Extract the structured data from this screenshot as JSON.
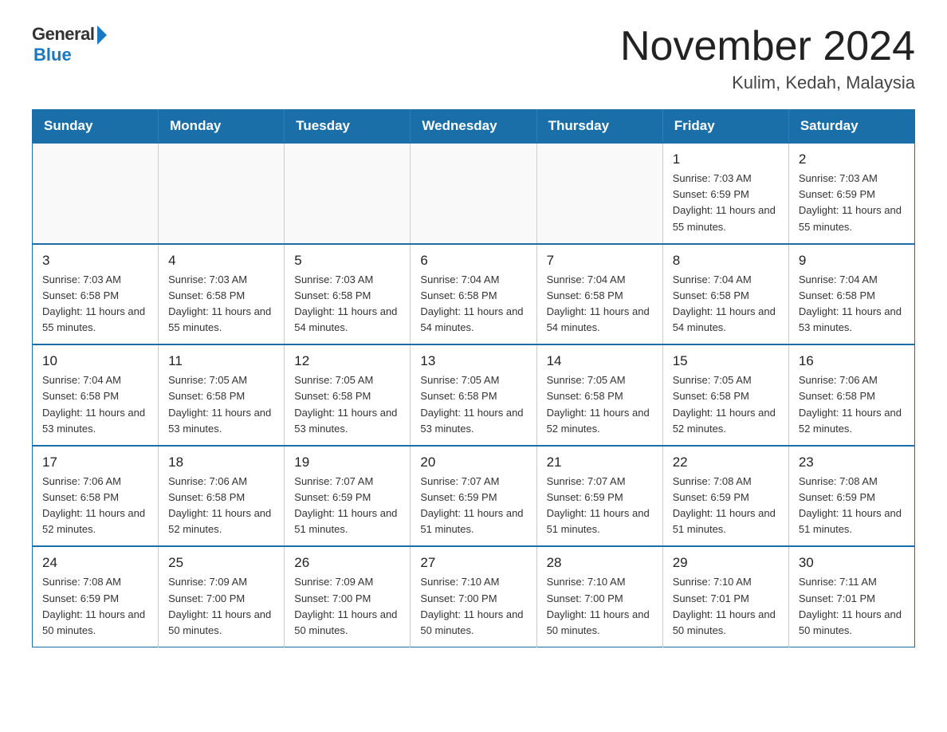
{
  "header": {
    "logo_general": "General",
    "logo_blue": "Blue",
    "title": "November 2024",
    "subtitle": "Kulim, Kedah, Malaysia"
  },
  "calendar": {
    "days_of_week": [
      "Sunday",
      "Monday",
      "Tuesday",
      "Wednesday",
      "Thursday",
      "Friday",
      "Saturday"
    ],
    "weeks": [
      [
        {
          "day": "",
          "info": ""
        },
        {
          "day": "",
          "info": ""
        },
        {
          "day": "",
          "info": ""
        },
        {
          "day": "",
          "info": ""
        },
        {
          "day": "",
          "info": ""
        },
        {
          "day": "1",
          "info": "Sunrise: 7:03 AM\nSunset: 6:59 PM\nDaylight: 11 hours and 55 minutes."
        },
        {
          "day": "2",
          "info": "Sunrise: 7:03 AM\nSunset: 6:59 PM\nDaylight: 11 hours and 55 minutes."
        }
      ],
      [
        {
          "day": "3",
          "info": "Sunrise: 7:03 AM\nSunset: 6:58 PM\nDaylight: 11 hours and 55 minutes."
        },
        {
          "day": "4",
          "info": "Sunrise: 7:03 AM\nSunset: 6:58 PM\nDaylight: 11 hours and 55 minutes."
        },
        {
          "day": "5",
          "info": "Sunrise: 7:03 AM\nSunset: 6:58 PM\nDaylight: 11 hours and 54 minutes."
        },
        {
          "day": "6",
          "info": "Sunrise: 7:04 AM\nSunset: 6:58 PM\nDaylight: 11 hours and 54 minutes."
        },
        {
          "day": "7",
          "info": "Sunrise: 7:04 AM\nSunset: 6:58 PM\nDaylight: 11 hours and 54 minutes."
        },
        {
          "day": "8",
          "info": "Sunrise: 7:04 AM\nSunset: 6:58 PM\nDaylight: 11 hours and 54 minutes."
        },
        {
          "day": "9",
          "info": "Sunrise: 7:04 AM\nSunset: 6:58 PM\nDaylight: 11 hours and 53 minutes."
        }
      ],
      [
        {
          "day": "10",
          "info": "Sunrise: 7:04 AM\nSunset: 6:58 PM\nDaylight: 11 hours and 53 minutes."
        },
        {
          "day": "11",
          "info": "Sunrise: 7:05 AM\nSunset: 6:58 PM\nDaylight: 11 hours and 53 minutes."
        },
        {
          "day": "12",
          "info": "Sunrise: 7:05 AM\nSunset: 6:58 PM\nDaylight: 11 hours and 53 minutes."
        },
        {
          "day": "13",
          "info": "Sunrise: 7:05 AM\nSunset: 6:58 PM\nDaylight: 11 hours and 53 minutes."
        },
        {
          "day": "14",
          "info": "Sunrise: 7:05 AM\nSunset: 6:58 PM\nDaylight: 11 hours and 52 minutes."
        },
        {
          "day": "15",
          "info": "Sunrise: 7:05 AM\nSunset: 6:58 PM\nDaylight: 11 hours and 52 minutes."
        },
        {
          "day": "16",
          "info": "Sunrise: 7:06 AM\nSunset: 6:58 PM\nDaylight: 11 hours and 52 minutes."
        }
      ],
      [
        {
          "day": "17",
          "info": "Sunrise: 7:06 AM\nSunset: 6:58 PM\nDaylight: 11 hours and 52 minutes."
        },
        {
          "day": "18",
          "info": "Sunrise: 7:06 AM\nSunset: 6:58 PM\nDaylight: 11 hours and 52 minutes."
        },
        {
          "day": "19",
          "info": "Sunrise: 7:07 AM\nSunset: 6:59 PM\nDaylight: 11 hours and 51 minutes."
        },
        {
          "day": "20",
          "info": "Sunrise: 7:07 AM\nSunset: 6:59 PM\nDaylight: 11 hours and 51 minutes."
        },
        {
          "day": "21",
          "info": "Sunrise: 7:07 AM\nSunset: 6:59 PM\nDaylight: 11 hours and 51 minutes."
        },
        {
          "day": "22",
          "info": "Sunrise: 7:08 AM\nSunset: 6:59 PM\nDaylight: 11 hours and 51 minutes."
        },
        {
          "day": "23",
          "info": "Sunrise: 7:08 AM\nSunset: 6:59 PM\nDaylight: 11 hours and 51 minutes."
        }
      ],
      [
        {
          "day": "24",
          "info": "Sunrise: 7:08 AM\nSunset: 6:59 PM\nDaylight: 11 hours and 50 minutes."
        },
        {
          "day": "25",
          "info": "Sunrise: 7:09 AM\nSunset: 7:00 PM\nDaylight: 11 hours and 50 minutes."
        },
        {
          "day": "26",
          "info": "Sunrise: 7:09 AM\nSunset: 7:00 PM\nDaylight: 11 hours and 50 minutes."
        },
        {
          "day": "27",
          "info": "Sunrise: 7:10 AM\nSunset: 7:00 PM\nDaylight: 11 hours and 50 minutes."
        },
        {
          "day": "28",
          "info": "Sunrise: 7:10 AM\nSunset: 7:00 PM\nDaylight: 11 hours and 50 minutes."
        },
        {
          "day": "29",
          "info": "Sunrise: 7:10 AM\nSunset: 7:01 PM\nDaylight: 11 hours and 50 minutes."
        },
        {
          "day": "30",
          "info": "Sunrise: 7:11 AM\nSunset: 7:01 PM\nDaylight: 11 hours and 50 minutes."
        }
      ]
    ]
  }
}
